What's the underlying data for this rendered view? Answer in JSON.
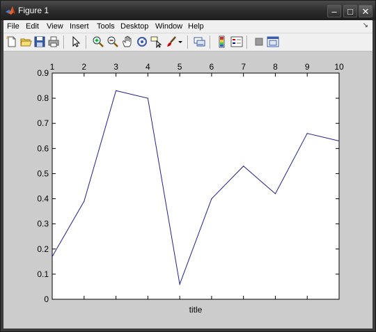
{
  "window": {
    "title": "Figure 1",
    "controls": {
      "minimize": "–",
      "maximize": "□",
      "close": "✕"
    }
  },
  "menubar": {
    "items": [
      "File",
      "Edit",
      "View",
      "Insert",
      "Tools",
      "Desktop",
      "Window",
      "Help"
    ]
  },
  "toolbar": {
    "buttons": [
      "new-figure-icon",
      "open-file-icon",
      "save-icon",
      "print-icon",
      "edit-plot-arrow-icon",
      "zoom-in-icon",
      "zoom-out-icon",
      "pan-hand-icon",
      "rotate-3d-icon",
      "data-cursor-icon",
      "brush-icon",
      "link-plot-icon",
      "colorbar-icon",
      "legend-icon",
      "hide-plot-tools-icon",
      "show-plot-tools-icon"
    ]
  },
  "colors": {
    "line": "#1f1f8c",
    "axes_bg": "#ffffff",
    "figure_bg": "#cccccc"
  },
  "chart_data": {
    "type": "line",
    "x": [
      1,
      2,
      3,
      4,
      5,
      6,
      7,
      8,
      9,
      10
    ],
    "series": [
      {
        "values": [
          0.17,
          0.39,
          0.83,
          0.8,
          0.06,
          0.4,
          0.53,
          0.42,
          0.66,
          0.63
        ]
      }
    ],
    "xlim": [
      1,
      10
    ],
    "ylim": [
      0,
      0.9
    ],
    "xticks": [
      "1",
      "2",
      "3",
      "4",
      "5",
      "6",
      "7",
      "8",
      "9",
      "10"
    ],
    "yticks": [
      "0",
      "0.1",
      "0.2",
      "0.3",
      "0.4",
      "0.5",
      "0.6",
      "0.7",
      "0.8",
      "0.9"
    ],
    "xtick_position": "top",
    "title": "",
    "xlabel": "title",
    "ylabel": "",
    "grid": false
  }
}
